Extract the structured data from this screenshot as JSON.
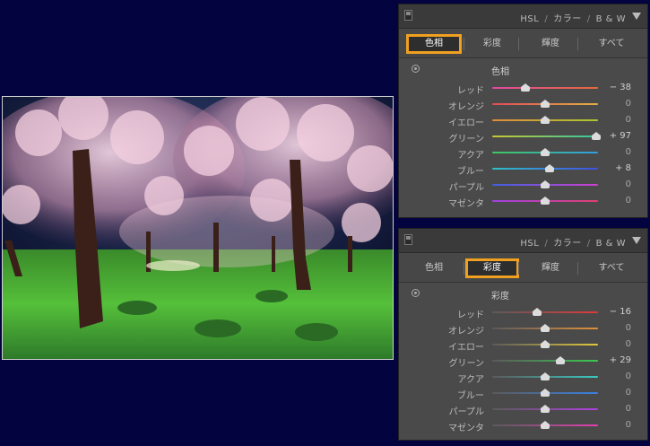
{
  "background_color": "#03033f",
  "photo": {
    "name": "cherry-blossom-night-photo"
  },
  "panels": [
    {
      "header": {
        "title1": "HSL",
        "sep": "/",
        "title2": "カラー",
        "title3": "B & W"
      },
      "tabs": [
        "色相",
        "彩度",
        "輝度",
        "すべて"
      ],
      "selected_tab": 0,
      "section_label": "色相",
      "sliders": [
        {
          "label": "レッド",
          "value": "− 38",
          "num": -38,
          "scale": 100,
          "color": "linear-gradient(90deg,#e04aa0,#e36a3a)"
        },
        {
          "label": "オレンジ",
          "value": "0",
          "num": 0,
          "scale": 100,
          "color": "linear-gradient(90deg,#e24a5a,#e2b040)"
        },
        {
          "label": "イエロー",
          "value": "0",
          "num": 0,
          "scale": 100,
          "color": "linear-gradient(90deg,#e08a3a,#a8c830)"
        },
        {
          "label": "グリーン",
          "value": "+ 97",
          "num": 97,
          "scale": 100,
          "color": "linear-gradient(90deg,#c8c830,#30c8a0)"
        },
        {
          "label": "アクア",
          "value": "0",
          "num": 0,
          "scale": 100,
          "color": "linear-gradient(90deg,#40c860,#30a0e0)"
        },
        {
          "label": "ブルー",
          "value": "+ 8",
          "num": 8,
          "scale": 100,
          "color": "linear-gradient(90deg,#30c0c8,#4050e0)"
        },
        {
          "label": "パープル",
          "value": "0",
          "num": 0,
          "scale": 100,
          "color": "linear-gradient(90deg,#4060e0,#d040d0)"
        },
        {
          "label": "マゼンタ",
          "value": "0",
          "num": 0,
          "scale": 100,
          "color": "linear-gradient(90deg,#a040e0,#e04070)"
        }
      ]
    },
    {
      "header": {
        "title1": "HSL",
        "sep": "/",
        "title2": "カラー",
        "title3": "B & W"
      },
      "tabs": [
        "色相",
        "彩度",
        "輝度",
        "すべて"
      ],
      "selected_tab": 1,
      "section_label": "彩度",
      "sliders": [
        {
          "label": "レッド",
          "value": "− 16",
          "num": -16,
          "scale": 100,
          "color": "linear-gradient(90deg,#5a5a5a,#e03a3a)"
        },
        {
          "label": "オレンジ",
          "value": "0",
          "num": 0,
          "scale": 100,
          "color": "linear-gradient(90deg,#5a5a5a,#e0903a)"
        },
        {
          "label": "イエロー",
          "value": "0",
          "num": 0,
          "scale": 100,
          "color": "linear-gradient(90deg,#5a5a5a,#e0c83a)"
        },
        {
          "label": "グリーン",
          "value": "+ 29",
          "num": 29,
          "scale": 100,
          "color": "linear-gradient(90deg,#5a5a5a,#3ac850)"
        },
        {
          "label": "アクア",
          "value": "0",
          "num": 0,
          "scale": 100,
          "color": "linear-gradient(90deg,#5a5a5a,#3ac8c0)"
        },
        {
          "label": "ブルー",
          "value": "0",
          "num": 0,
          "scale": 100,
          "color": "linear-gradient(90deg,#5a5a5a,#3a80e0)"
        },
        {
          "label": "パープル",
          "value": "0",
          "num": 0,
          "scale": 100,
          "color": "linear-gradient(90deg,#5a5a5a,#b040e0)"
        },
        {
          "label": "マゼンタ",
          "value": "0",
          "num": 0,
          "scale": 100,
          "color": "linear-gradient(90deg,#5a5a5a,#e040b0)"
        }
      ]
    }
  ]
}
